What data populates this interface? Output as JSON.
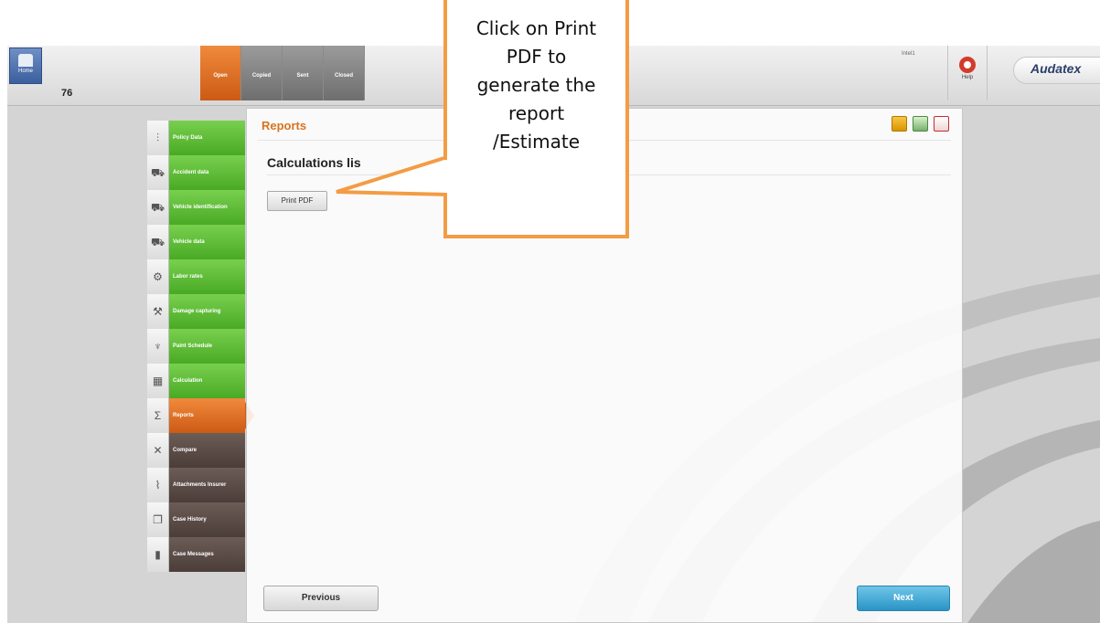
{
  "page_title": "",
  "app": {
    "home_label": "Home",
    "case_number": "76",
    "status_tabs": [
      {
        "label": "Open",
        "active": true
      },
      {
        "label": "Copied",
        "active": false
      },
      {
        "label": "Sent",
        "active": false
      },
      {
        "label": "Closed",
        "active": false
      }
    ],
    "user_label": "Intel1",
    "help_label": "Help",
    "brand_name": "Audatex"
  },
  "nav": {
    "items": [
      {
        "label": "Policy Data",
        "icon": "sliders-icon",
        "state": "done"
      },
      {
        "label": "Accident data",
        "icon": "car-icon",
        "state": "done"
      },
      {
        "label": "Vehicle identification",
        "icon": "car-icon",
        "state": "done"
      },
      {
        "label": "Vehicle data",
        "icon": "car-icon",
        "state": "done"
      },
      {
        "label": "Labor rates",
        "icon": "labor-icon",
        "state": "done"
      },
      {
        "label": "Damage capturing",
        "icon": "hammer-icon",
        "state": "done"
      },
      {
        "label": "Paint Schedule",
        "icon": "spray-icon",
        "state": "done"
      },
      {
        "label": "Calculation",
        "icon": "calculator-icon",
        "state": "done"
      },
      {
        "label": "Reports",
        "icon": "sigma-icon",
        "state": "active"
      },
      {
        "label": "Compare",
        "icon": "compare-icon",
        "state": "todo"
      },
      {
        "label": "Attachments Insurer",
        "icon": "paperclip-icon",
        "state": "todo"
      },
      {
        "label": "Case History",
        "icon": "history-icon",
        "state": "todo"
      },
      {
        "label": "Case Messages",
        "icon": "messages-icon",
        "state": "todo"
      }
    ]
  },
  "panel": {
    "title": "Reports",
    "calculations_title": "Calculations lis",
    "print_pdf_label": "Print PDF",
    "previous_label": "Previous",
    "next_label": "Next"
  },
  "callout": {
    "text": "Click on Print\nPDF to\ngenerate the\nreport\n/Estimate"
  },
  "colors": {
    "accent_orange": "#e8822a",
    "done_green": "#5cbf35",
    "todo_brown": "#5a4a44",
    "next_blue": "#3aa6d6",
    "callout_border": "#f39c44"
  }
}
